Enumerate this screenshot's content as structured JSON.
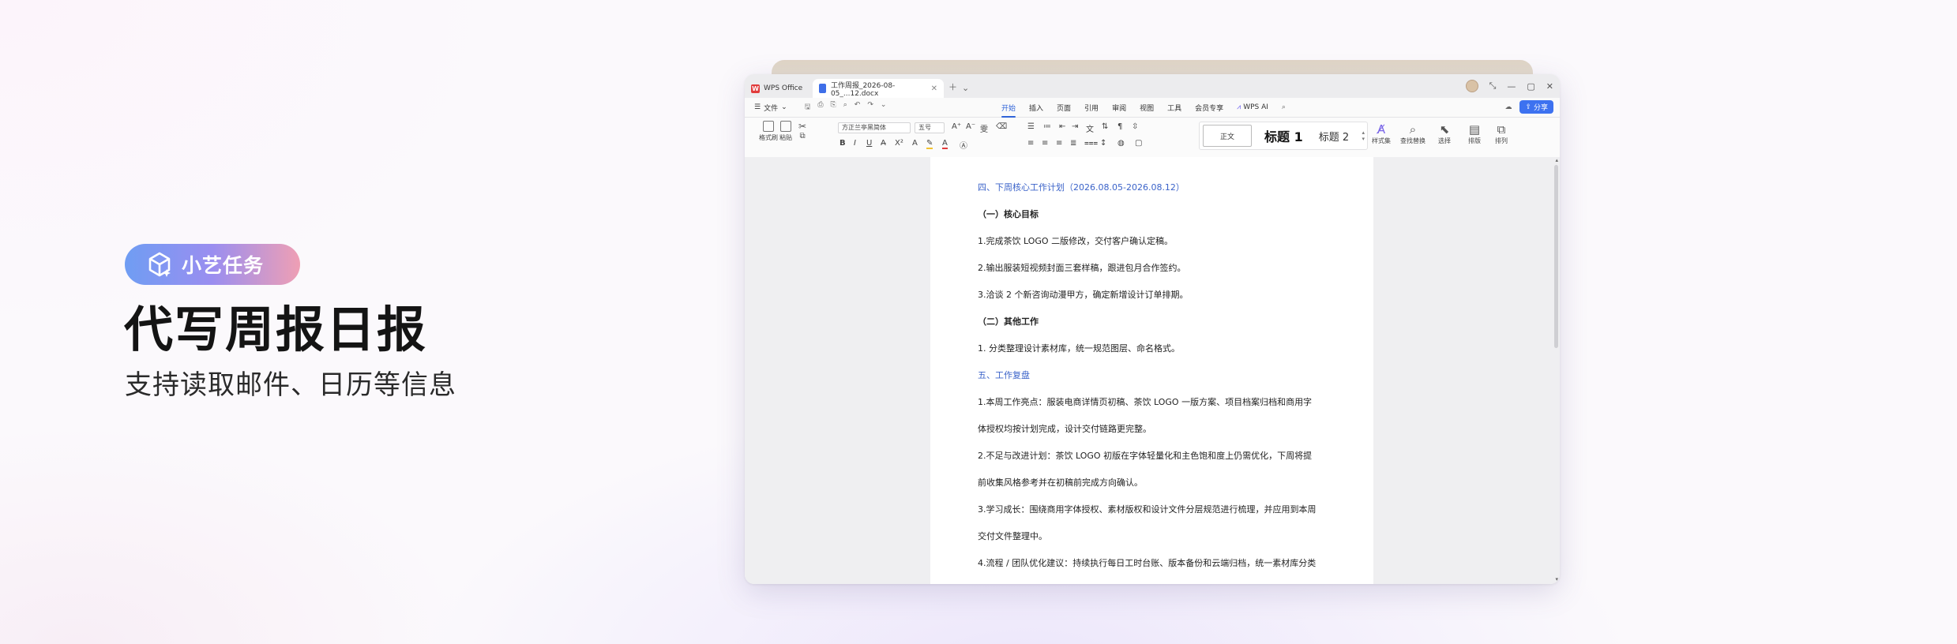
{
  "hero": {
    "badge": "小艺任务",
    "title": "代写周报日报",
    "subtitle": "支持读取邮件、日历等信息"
  },
  "window": {
    "tabs": [
      {
        "label": "WPS Office"
      },
      {
        "label": "工作周报_2026-08-05_...12.docx"
      }
    ],
    "menu": {
      "file": "文件",
      "tabs": [
        "开始",
        "插入",
        "页面",
        "引用",
        "审阅",
        "视图",
        "工具",
        "会员专享"
      ],
      "active_tab": "开始",
      "ai": "WPS AI",
      "share": "分享"
    },
    "ribbon": {
      "format_painter": "格式刷",
      "paste": "粘贴",
      "font": "方正兰亭黑简体",
      "size": "五号",
      "styles": [
        "正文",
        "标题 1",
        "标题 2"
      ],
      "style_set": "样式集",
      "find_replace": "查找替换",
      "select": "选择",
      "layout": "排版",
      "arrange": "排列"
    },
    "accent": "#3d72f0"
  },
  "document": {
    "lines": [
      "四、下周核心工作计划（2026.08.05-2026.08.12）",
      "（一）核心目标",
      "1.完成茶饮 LOGO 二版修改，交付客户确认定稿。",
      "2.输出服装短视频封面三套样稿，跟进包月合作签约。",
      "3.洽谈 2 个新咨询动漫甲方，确定新增设计订单排期。",
      "（二）其他工作",
      "1. 分类整理设计素材库，统一规范图层、命名格式。",
      "五、工作复盘",
      "1.本周工作亮点：服装电商详情页初稿、茶饮 LOGO 一版方案、项目档案归档和商用字",
      "体授权均按计划完成，设计交付链路更完整。",
      "2.不足与改进计划：茶饮 LOGO 初版在字体轻量化和主色饱和度上仍需优化，下周将提",
      "前收集风格参考并在初稿前完成方向确认。",
      "3.学习成长：围绕商用字体授权、素材版权和设计文件分层规范进行梳理，并应用到本周",
      "交付文件整理中。",
      "4.流程 / 团队优化建议：持续执行每日工时台账、版本备份和云端归档，统一素材库分类"
    ]
  }
}
